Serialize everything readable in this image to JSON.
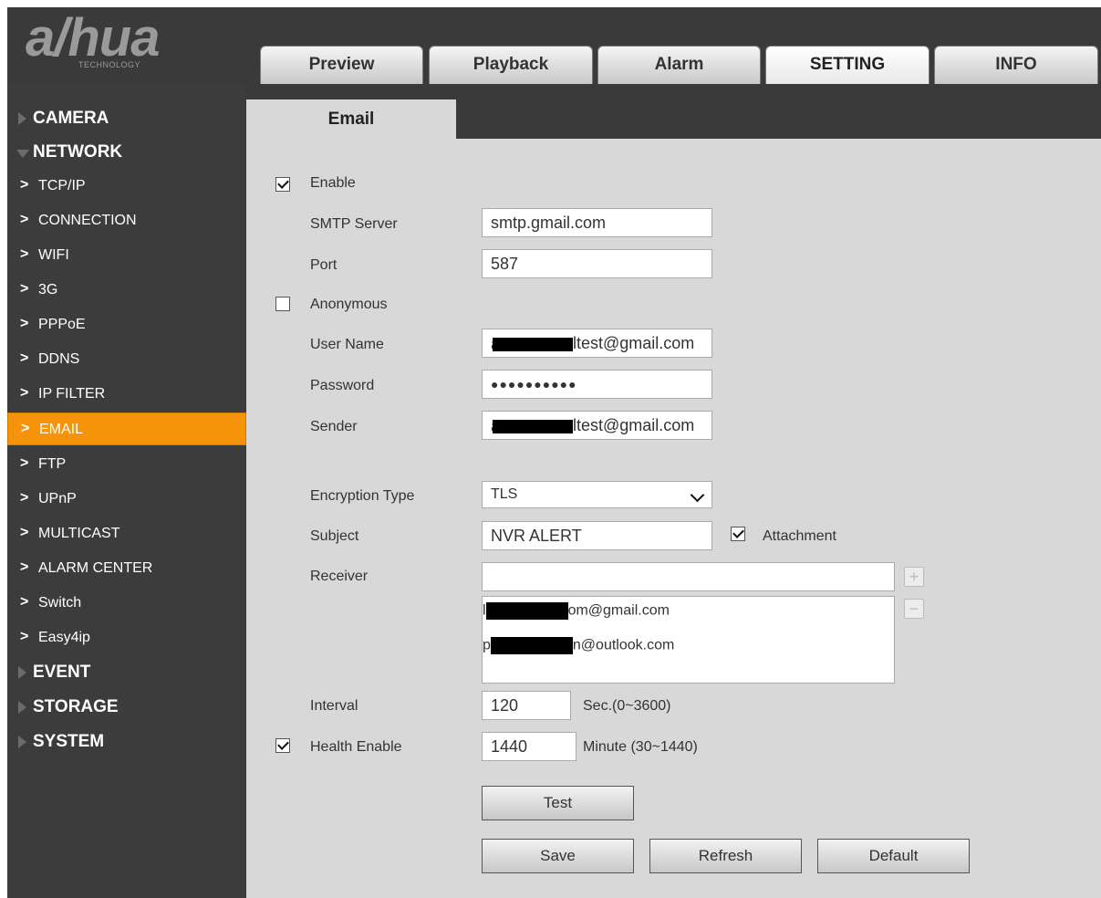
{
  "brand": {
    "logo_text": "a/hua",
    "logo_sub": "TECHNOLOGY"
  },
  "top_tabs": [
    "Preview",
    "Playback",
    "Alarm",
    "SETTING",
    "INFO"
  ],
  "active_top_tab": "SETTING",
  "sidebar": {
    "categories": {
      "camera": "CAMERA",
      "network": "NETWORK",
      "event": "EVENT",
      "storage": "STORAGE",
      "system": "SYSTEM"
    },
    "network_items": [
      "TCP/IP",
      "CONNECTION",
      "WIFI",
      "3G",
      "PPPoE",
      "DDNS",
      "IP FILTER",
      "EMAIL",
      "FTP",
      "UPnP",
      "MULTICAST",
      "ALARM CENTER",
      "Switch",
      "Easy4ip"
    ],
    "selected_item": "EMAIL",
    "chevron": ">"
  },
  "page": {
    "tab_title": "Email",
    "enable": {
      "label": "Enable",
      "checked": true
    },
    "smtp_server": {
      "label": "SMTP Server",
      "value": "smtp.gmail.com"
    },
    "port": {
      "label": "Port",
      "value": "587"
    },
    "anonymous": {
      "label": "Anonymous",
      "checked": false
    },
    "user_name": {
      "label": "User Name",
      "value_prefix": "a",
      "value_suffix": "ltest@gmail.com"
    },
    "password": {
      "label": "Password",
      "value": "●●●●●●●●●●"
    },
    "sender": {
      "label": "Sender",
      "value_prefix": "a",
      "value_suffix": "ltest@gmail.com"
    },
    "encryption": {
      "label": "Encryption Type",
      "value": "TLS"
    },
    "subject": {
      "label": "Subject",
      "value": "NVR ALERT"
    },
    "attachment": {
      "label": "Attachment",
      "checked": true
    },
    "receiver": {
      "label": "Receiver",
      "input_value": "",
      "list": [
        {
          "prefix": "l",
          "suffix": "om@gmail.com"
        },
        {
          "prefix": "p",
          "suffix": "n@outlook.com"
        }
      ],
      "add_symbol": "+",
      "remove_symbol": "−"
    },
    "interval": {
      "label": "Interval",
      "value": "120",
      "unit": "Sec.(0~3600)"
    },
    "health": {
      "label": "Health Enable",
      "checked": true,
      "value": "1440",
      "unit": "Minute (30~1440)"
    },
    "buttons": {
      "test": "Test",
      "save": "Save",
      "refresh": "Refresh",
      "default": "Default"
    }
  }
}
